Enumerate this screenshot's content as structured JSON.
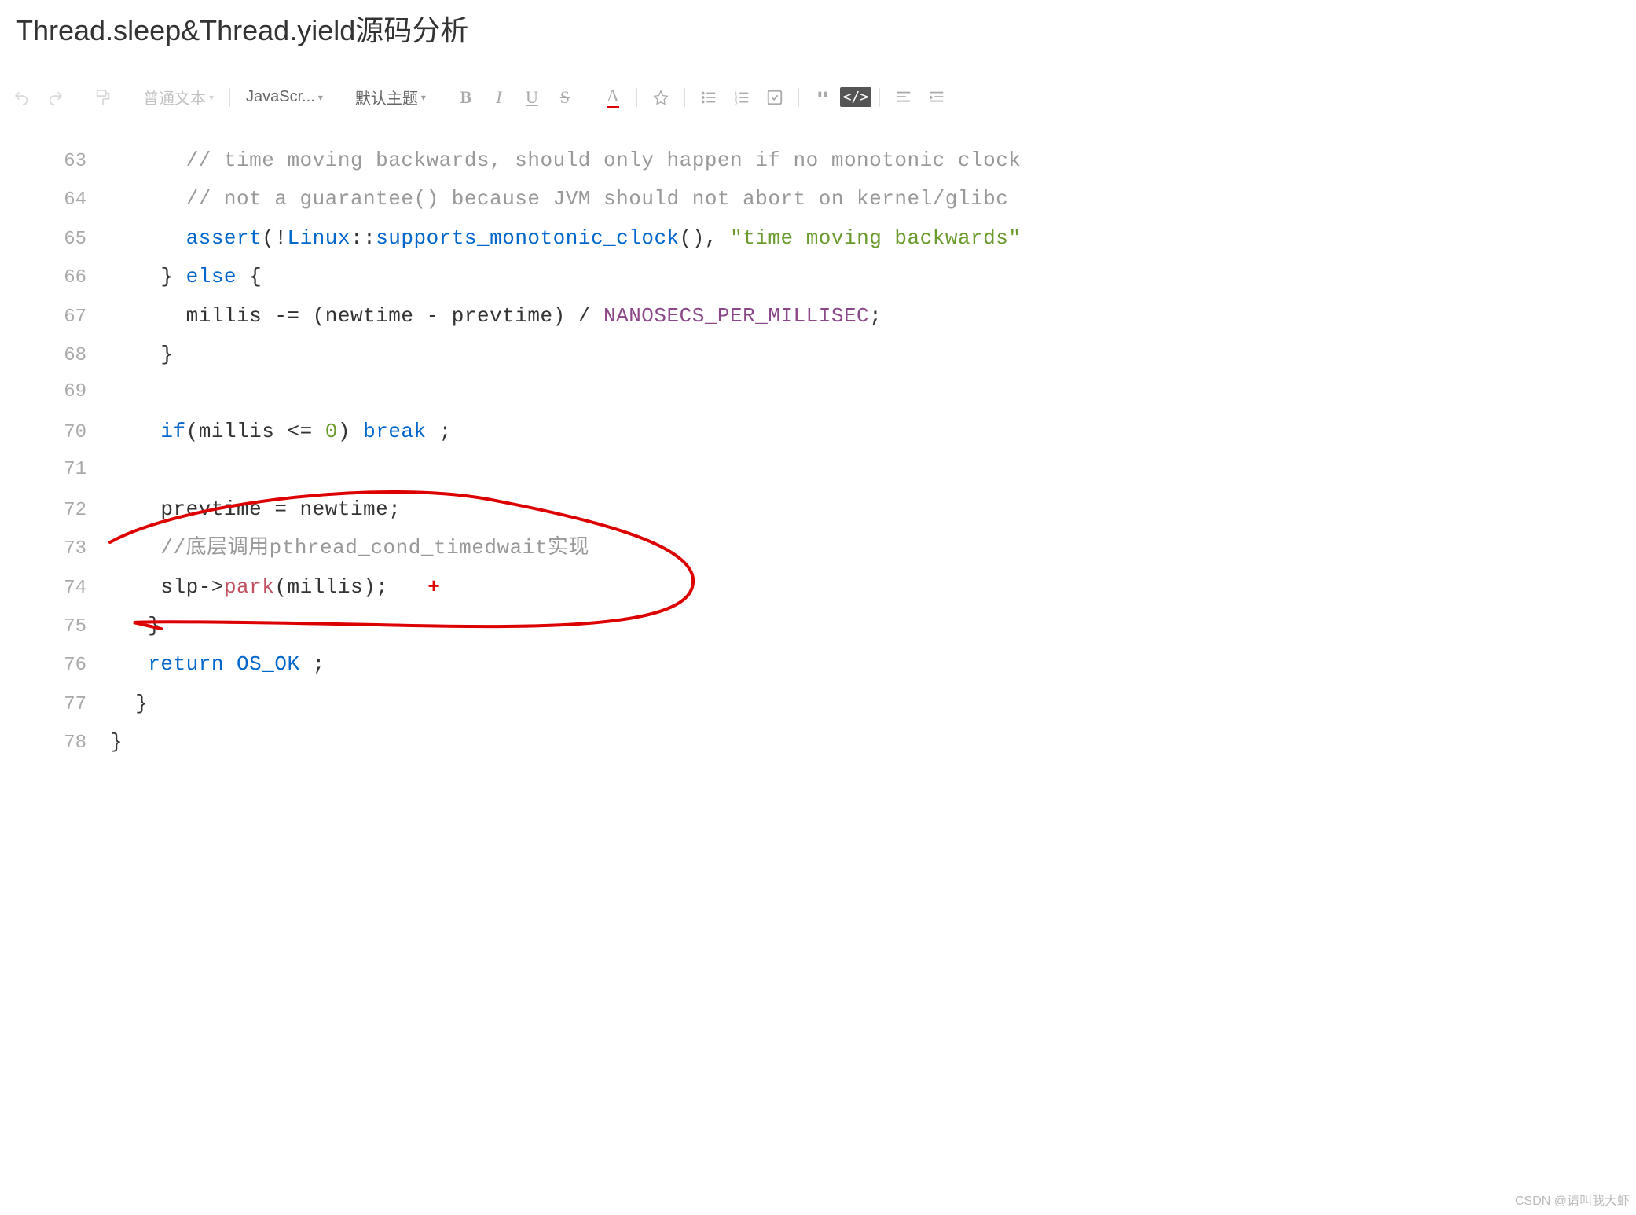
{
  "title": "Thread.sleep&Thread.yield源码分析",
  "toolbar": {
    "paragraph_style": "普通文本",
    "language": "JavaScr...",
    "theme": "默认主题"
  },
  "code": {
    "lines": [
      {
        "num": "63",
        "segments": [
          {
            "text": "      ",
            "cls": ""
          },
          {
            "text": "// time moving backwards, should only happen if no monotonic clock",
            "cls": "comment"
          }
        ]
      },
      {
        "num": "64",
        "segments": [
          {
            "text": "      ",
            "cls": ""
          },
          {
            "text": "// not a guarantee() because JVM should not abort on kernel/glibc",
            "cls": "comment"
          }
        ]
      },
      {
        "num": "65",
        "segments": [
          {
            "text": "      ",
            "cls": ""
          },
          {
            "text": "assert",
            "cls": "function"
          },
          {
            "text": "(!",
            "cls": ""
          },
          {
            "text": "Linux",
            "cls": "classname"
          },
          {
            "text": "::",
            "cls": ""
          },
          {
            "text": "supports_monotonic_clock",
            "cls": "function"
          },
          {
            "text": "(), ",
            "cls": ""
          },
          {
            "text": "\"time moving backwards\"",
            "cls": "string"
          }
        ]
      },
      {
        "num": "66",
        "segments": [
          {
            "text": "    } ",
            "cls": ""
          },
          {
            "text": "else",
            "cls": "keyword"
          },
          {
            "text": " {",
            "cls": ""
          }
        ]
      },
      {
        "num": "67",
        "segments": [
          {
            "text": "      millis -= (newtime - prevtime) / ",
            "cls": ""
          },
          {
            "text": "NANOSECS_PER_MILLISEC",
            "cls": "constant"
          },
          {
            "text": ";",
            "cls": ""
          }
        ]
      },
      {
        "num": "68",
        "segments": [
          {
            "text": "    }",
            "cls": ""
          }
        ]
      },
      {
        "num": "69",
        "segments": [
          {
            "text": "",
            "cls": ""
          }
        ]
      },
      {
        "num": "70",
        "segments": [
          {
            "text": "    ",
            "cls": ""
          },
          {
            "text": "if",
            "cls": "keyword"
          },
          {
            "text": "(millis <= ",
            "cls": ""
          },
          {
            "text": "0",
            "cls": "number"
          },
          {
            "text": ") ",
            "cls": ""
          },
          {
            "text": "break",
            "cls": "keyword"
          },
          {
            "text": " ;",
            "cls": ""
          }
        ]
      },
      {
        "num": "71",
        "segments": [
          {
            "text": "",
            "cls": ""
          }
        ]
      },
      {
        "num": "72",
        "segments": [
          {
            "text": "    prevtime = newtime;",
            "cls": ""
          }
        ]
      },
      {
        "num": "73",
        "segments": [
          {
            "text": "    ",
            "cls": ""
          },
          {
            "text": "//底层调用pthread_cond_timedwait实现",
            "cls": "comment"
          }
        ]
      },
      {
        "num": "74",
        "segments": [
          {
            "text": "    slp->",
            "cls": ""
          },
          {
            "text": "park",
            "cls": "method"
          },
          {
            "text": "(millis);",
            "cls": ""
          }
        ],
        "has_cross": true
      },
      {
        "num": "75",
        "segments": [
          {
            "text": "   }",
            "cls": ""
          }
        ]
      },
      {
        "num": "76",
        "segments": [
          {
            "text": "   ",
            "cls": ""
          },
          {
            "text": "return",
            "cls": "keyword"
          },
          {
            "text": " ",
            "cls": ""
          },
          {
            "text": "OS_OK",
            "cls": "classname"
          },
          {
            "text": " ;",
            "cls": ""
          }
        ]
      },
      {
        "num": "77",
        "segments": [
          {
            "text": "  }",
            "cls": ""
          }
        ]
      },
      {
        "num": "78",
        "segments": [
          {
            "text": "}",
            "cls": ""
          }
        ]
      }
    ]
  },
  "watermark": "CSDN @请叫我大虾"
}
